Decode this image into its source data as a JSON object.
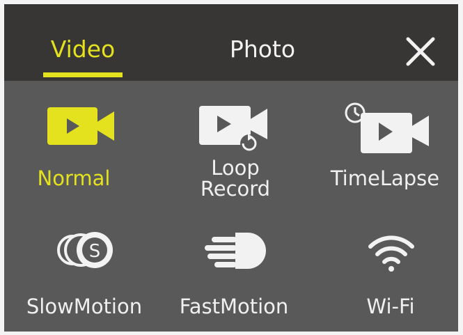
{
  "tabs": [
    {
      "label": "Video",
      "active": true
    },
    {
      "label": "Photo",
      "active": false
    }
  ],
  "close_icon": "close-icon",
  "modes": [
    {
      "id": "normal",
      "label": "Normal",
      "icon": "video-camera-icon",
      "active": true
    },
    {
      "id": "loop",
      "label_line1": "Loop",
      "label_line2": "Record",
      "icon": "loop-record-icon",
      "active": false
    },
    {
      "id": "timelapse",
      "label": "TimeLapse",
      "icon": "timelapse-icon",
      "active": false
    },
    {
      "id": "slowmotion",
      "label": "SlowMotion",
      "icon": "slow-motion-icon",
      "active": false
    },
    {
      "id": "fastmotion",
      "label": "FastMotion",
      "icon": "fast-motion-icon",
      "active": false
    },
    {
      "id": "wifi",
      "label": "Wi-Fi",
      "icon": "wifi-icon",
      "active": false
    }
  ],
  "colors": {
    "accent": "#e4e21f",
    "topbar": "#383634",
    "panel": "#595959",
    "text": "#f0f0f0"
  }
}
